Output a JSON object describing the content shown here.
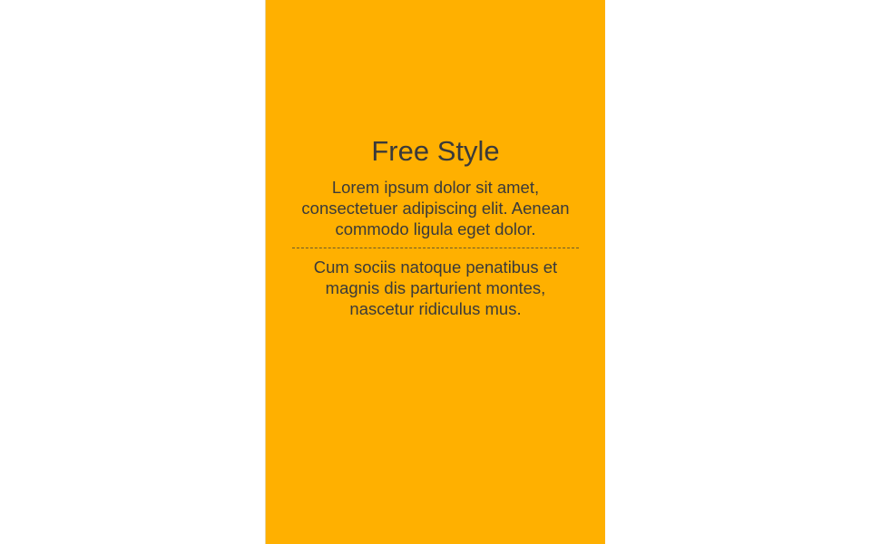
{
  "panel": {
    "background": "#ffb000",
    "title": "Free Style",
    "paragraph_1": "Lorem ipsum dolor sit amet, consectetuer adipiscing elit. Aenean commodo ligula eget dolor.",
    "paragraph_2": "Cum sociis natoque penatibus et magnis dis parturient montes, nascetur ridiculus mus."
  }
}
